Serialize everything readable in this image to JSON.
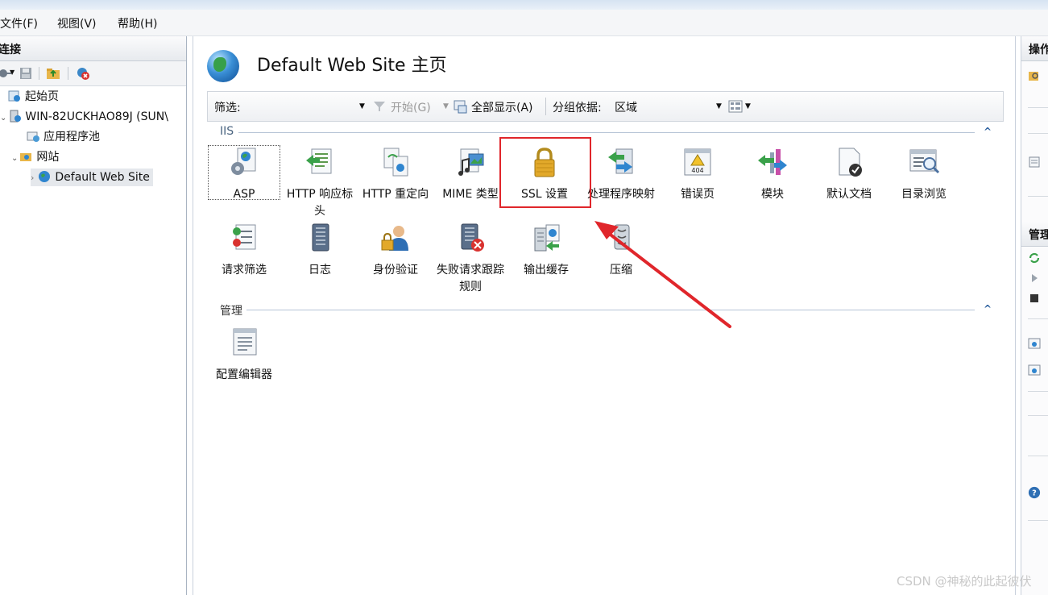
{
  "menu": {
    "file": "文件(F)",
    "view": "视图(V)",
    "help": "帮助(H)"
  },
  "connections": {
    "title": "连接",
    "tree": {
      "start_page": "起始页",
      "server": "WIN-82UCKHAO89J (SUN\\",
      "app_pools": "应用程序池",
      "sites": "网站",
      "default_site": "Default Web Site"
    }
  },
  "main": {
    "title": "Default Web Site 主页",
    "filter": {
      "label": "筛选:",
      "value": "",
      "start": "开始(G)",
      "show_all": "全部显示(A)",
      "group_by_label": "分组依据:",
      "group_by_value": "区域"
    },
    "groups": {
      "iis": "IIS",
      "management": "管理"
    },
    "iis_features": [
      {
        "label": "ASP",
        "icon": "asp-gear-icon"
      },
      {
        "label": "HTTP 响应标头",
        "icon": "http-response-headers-icon"
      },
      {
        "label": "HTTP 重定向",
        "icon": "http-redirect-icon"
      },
      {
        "label": "MIME 类型",
        "icon": "mime-types-icon"
      },
      {
        "label": "SSL 设置",
        "icon": "lock-icon"
      },
      {
        "label": "处理程序映射",
        "icon": "handler-mappings-icon"
      },
      {
        "label": "错误页",
        "icon": "error-pages-404-icon"
      },
      {
        "label": "模块",
        "icon": "modules-icon"
      },
      {
        "label": "默认文档",
        "icon": "default-document-icon"
      },
      {
        "label": "目录浏览",
        "icon": "directory-browsing-icon"
      },
      {
        "label": "请求筛选",
        "icon": "request-filtering-icon"
      },
      {
        "label": "日志",
        "icon": "logging-icon"
      },
      {
        "label": "身份验证",
        "icon": "authentication-user-icon"
      },
      {
        "label": "失败请求跟踪规则",
        "icon": "failed-request-tracing-icon"
      },
      {
        "label": "输出缓存",
        "icon": "output-caching-icon"
      },
      {
        "label": "压缩",
        "icon": "compression-icon"
      }
    ],
    "management_features": [
      {
        "label": "配置编辑器",
        "icon": "configuration-editor-icon"
      }
    ]
  },
  "actions": {
    "title": "操作",
    "manage": "管理"
  },
  "watermark": "CSDN @神秘的此起彼伏"
}
